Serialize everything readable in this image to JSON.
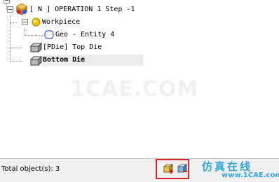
{
  "tree": {
    "root_label": "[ N ]  OPERATION 1  Step -1",
    "workpiece_label": "Workpiece",
    "geo_label": "Geo - Entity 4",
    "top_die_label": "[PDie] Top Die",
    "bottom_die_label": "Bottom Die"
  },
  "watermark": {
    "text": "1CAE.COM"
  },
  "status": {
    "text": "Total object(s): 3"
  },
  "toolbar": {
    "add_object_icon": "add-object-icon",
    "remove_object_icon": "remove-object-icon"
  },
  "watermark_corner": {
    "cn_text": "仿真在线",
    "url_text": "www.1CAE.com"
  },
  "colors": {
    "highlight": "#e8202a",
    "watermark_blue": "#2ea7e0",
    "workpiece_icon": "#f2c400",
    "geo_icon": "#3b4fd6"
  }
}
